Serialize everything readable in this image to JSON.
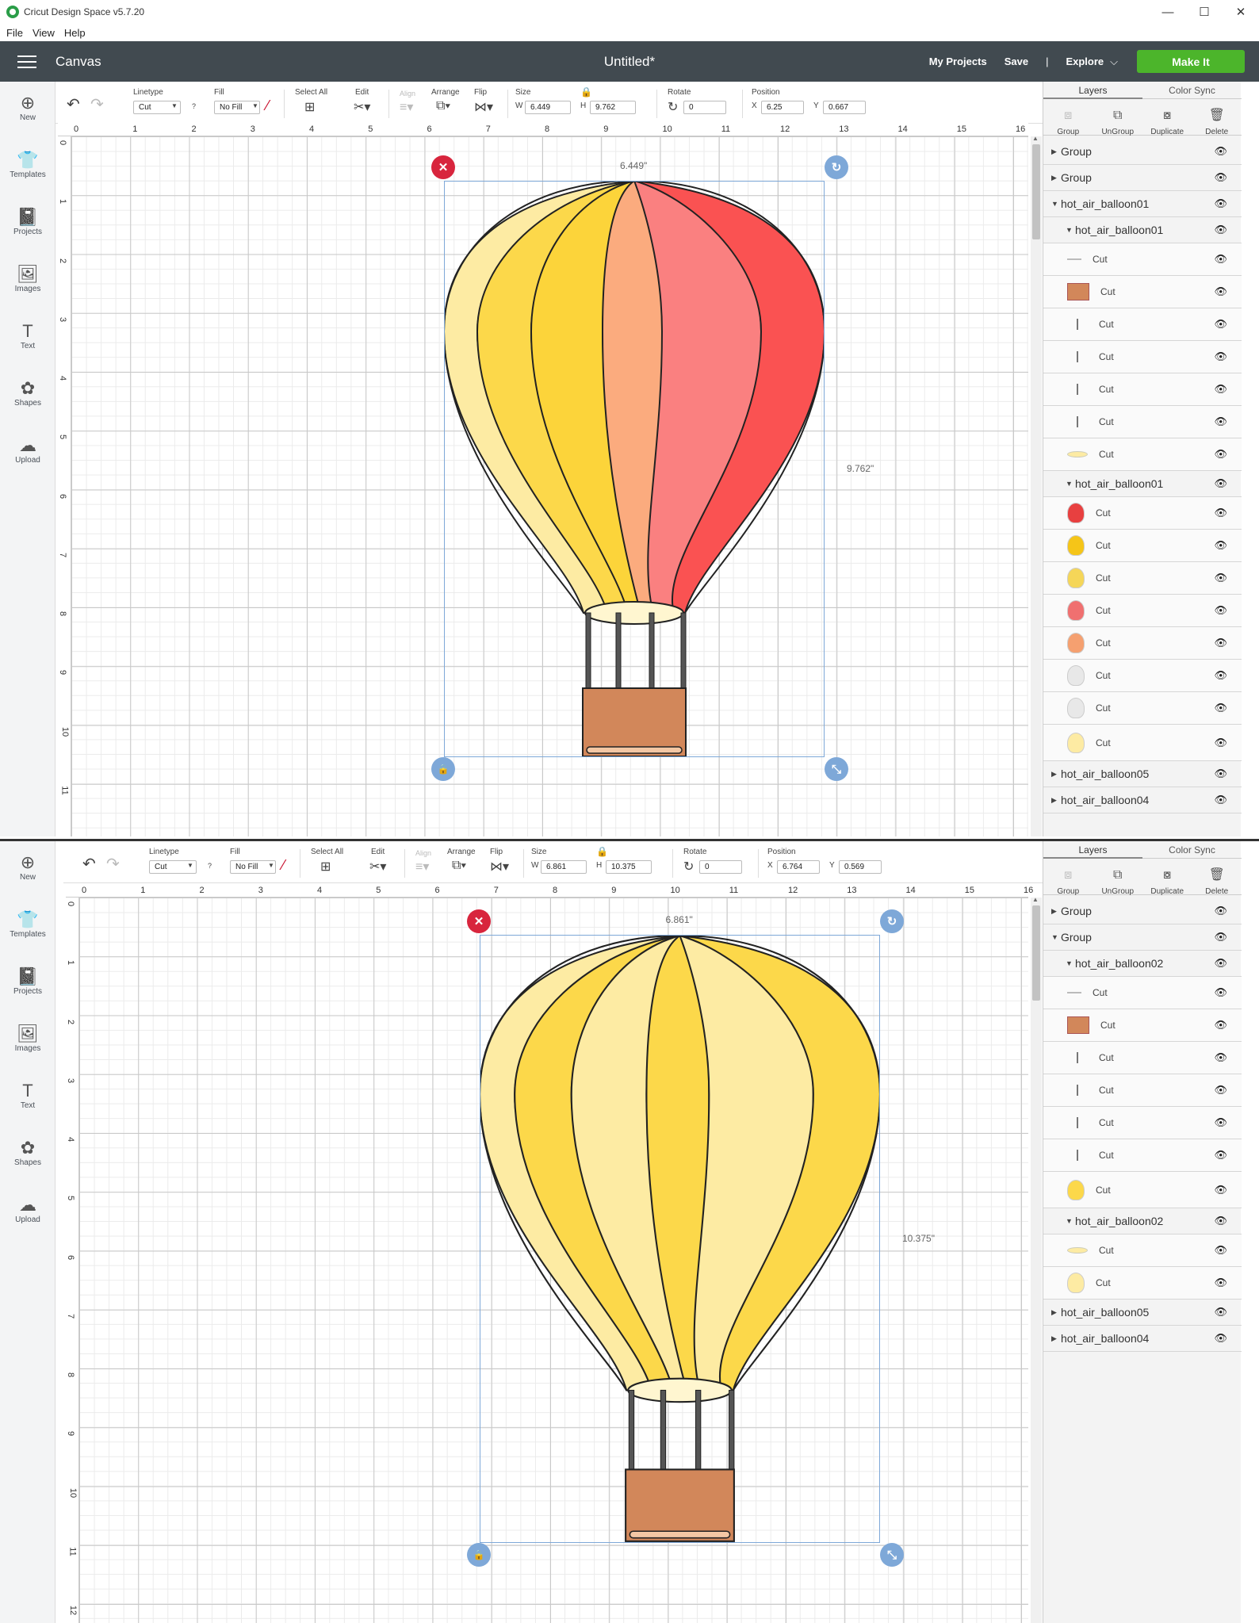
{
  "window": {
    "logo": "cricut-logo-icon",
    "title": "Cricut Design Space  v5.7.20",
    "controls": [
      "—",
      "☐",
      "✕"
    ]
  },
  "menu": [
    "File",
    "View",
    "Help"
  ],
  "header": {
    "canvas_label": "Canvas",
    "doc_title": "Untitled*",
    "my_projects": "My Projects",
    "save": "Save",
    "divider": "|",
    "explore": "Explore",
    "make_it": "Make It"
  },
  "sidebar": [
    "New",
    "Templates",
    "Projects",
    "Images",
    "Text",
    "Shapes",
    "Upload"
  ],
  "toolbar_labels": {
    "linetype": "Linetype",
    "fill": "Fill",
    "select_all": "Select All",
    "edit": "Edit",
    "align": "Align",
    "arrange": "Arrange",
    "flip": "Flip",
    "size": "Size",
    "rotate": "Rotate",
    "position": "Position"
  },
  "panels": [
    {
      "linetype": "Cut",
      "fill": "No Fill",
      "w": "6.449",
      "h": "9.762",
      "rotate": "0",
      "x": "6.25",
      "y": "0.667",
      "width_label": "6.449\"",
      "height_label": "9.762\"",
      "ruler_h": [
        "0",
        "1",
        "2",
        "3",
        "4",
        "5",
        "6",
        "7",
        "8",
        "9",
        "10",
        "11",
        "12",
        "13",
        "14",
        "15",
        "16"
      ],
      "ruler_v": [
        "0",
        "1",
        "2",
        "3",
        "4",
        "5",
        "6",
        "7",
        "8",
        "9",
        "10",
        "11"
      ],
      "balloon_colors": [
        "#fdeba3",
        "#fcd84a",
        "#fcd43a",
        "#fbab7e",
        "#fa8080",
        "#fa5252",
        "#fdeba3"
      ],
      "layers": [
        {
          "label": "Group",
          "expanded": false
        },
        {
          "label": "Group",
          "expanded": false
        },
        {
          "label": "hot_air_balloon01",
          "expanded": true
        },
        {
          "label": "hot_air_balloon01",
          "expanded": true
        },
        {
          "label": "Cut",
          "swatch": "line"
        },
        {
          "label": "Cut",
          "swatch": "#d2875a"
        },
        {
          "label": "Cut",
          "swatch": "bar"
        },
        {
          "label": "Cut",
          "swatch": "bar"
        },
        {
          "label": "Cut",
          "swatch": "bar"
        },
        {
          "label": "Cut",
          "swatch": "bar"
        },
        {
          "label": "Cut",
          "swatch": "ellipse"
        },
        {
          "label": "hot_air_balloon01",
          "expanded": true
        },
        {
          "label": "Cut",
          "swatch": "#e84040"
        },
        {
          "label": "Cut",
          "swatch": "#f5c518"
        },
        {
          "label": "Cut",
          "swatch": "#f5d658"
        },
        {
          "label": "Cut",
          "swatch": "#f07070"
        },
        {
          "label": "Cut",
          "swatch": "#f5a070"
        },
        {
          "label": "Cut",
          "swatch": "#e8e8e8"
        },
        {
          "label": "Cut",
          "swatch": "#e8e8e8"
        },
        {
          "label": "Cut",
          "swatch": "#fdeba3"
        },
        {
          "label": "hot_air_balloon05",
          "expanded": false
        },
        {
          "label": "hot_air_balloon04",
          "expanded": false
        }
      ]
    },
    {
      "linetype": "Cut",
      "fill": "No Fill",
      "w": "6.861",
      "h": "10.375",
      "rotate": "0",
      "x": "6.764",
      "y": "0.569",
      "width_label": "6.861\"",
      "height_label": "10.375\"",
      "ruler_h": [
        "0",
        "1",
        "2",
        "3",
        "4",
        "5",
        "6",
        "7",
        "8",
        "9",
        "10",
        "11",
        "12",
        "13",
        "14",
        "15",
        "16"
      ],
      "ruler_v": [
        "0",
        "1",
        "2",
        "3",
        "4",
        "5",
        "6",
        "7",
        "8",
        "9",
        "10",
        "11",
        "12"
      ],
      "balloon_colors": [
        "#fdeba3",
        "#fcd84a",
        "#fdeba3",
        "#fcd84a",
        "#fdeba3",
        "#fcd84a",
        "#fdeba3"
      ],
      "layers": [
        {
          "label": "Group",
          "expanded": false
        },
        {
          "label": "Group",
          "expanded": true
        },
        {
          "label": "hot_air_balloon02",
          "expanded": true
        },
        {
          "label": "Cut",
          "swatch": "line"
        },
        {
          "label": "Cut",
          "swatch": "#d2875a"
        },
        {
          "label": "Cut",
          "swatch": "bar"
        },
        {
          "label": "Cut",
          "swatch": "bar"
        },
        {
          "label": "Cut",
          "swatch": "bar"
        },
        {
          "label": "Cut",
          "swatch": "bar"
        },
        {
          "label": "Cut",
          "swatch": "#fcd84a"
        },
        {
          "label": "hot_air_balloon02",
          "expanded": true
        },
        {
          "label": "Cut",
          "swatch": "ellipse"
        },
        {
          "label": "Cut",
          "swatch": "#fdeba3"
        },
        {
          "label": "hot_air_balloon05",
          "expanded": false
        },
        {
          "label": "hot_air_balloon04",
          "expanded": false
        }
      ]
    }
  ],
  "layers_panel": {
    "tab_layers": "Layers",
    "tab_color_sync": "Color Sync",
    "actions": [
      "Group",
      "UnGroup",
      "Duplicate",
      "Delete"
    ]
  }
}
